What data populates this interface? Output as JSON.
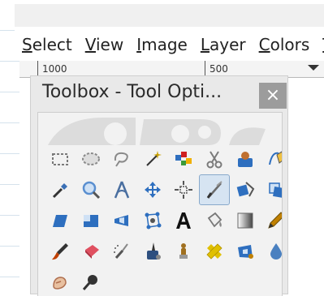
{
  "menubar": {
    "items": [
      {
        "label": "Select",
        "mnemonic": "S",
        "rest": "elect"
      },
      {
        "label": "View",
        "mnemonic": "V",
        "rest": "iew"
      },
      {
        "label": "Image",
        "mnemonic": "I",
        "rest": "mage"
      },
      {
        "label": "Layer",
        "mnemonic": "L",
        "rest": "ayer"
      },
      {
        "label": "Colors",
        "mnemonic": "C",
        "rest": "olors"
      },
      {
        "label": "To",
        "mnemonic": "T",
        "rest": "o"
      }
    ]
  },
  "ruler": {
    "labels": [
      "1000",
      "500"
    ]
  },
  "toolbox": {
    "title": "Toolbox - Tool Opti...",
    "close_glyph": "×"
  },
  "tools": [
    {
      "name": "rect-select-icon",
      "color": "#7a7a7a"
    },
    {
      "name": "ellipse-select-icon",
      "color": "#8a8a8a"
    },
    {
      "name": "free-select-icon",
      "color": "#8a8a8a"
    },
    {
      "name": "fuzzy-select-icon",
      "color": "#c8a000"
    },
    {
      "name": "select-by-color-icon",
      "color": "#d02020"
    },
    {
      "name": "scissors-select-icon",
      "color": "#7a7a7a"
    },
    {
      "name": "foreground-select-icon",
      "color": "#2e6fbf"
    },
    {
      "name": "paths-icon",
      "color": "#2e6fbf"
    },
    {
      "name": "color-picker-icon",
      "color": "#3a6fb5"
    },
    {
      "name": "zoom-icon",
      "color": "#5a8fd0"
    },
    {
      "name": "measure-icon",
      "color": "#4a6fa0"
    },
    {
      "name": "move-icon",
      "color": "#2e6fbf"
    },
    {
      "name": "alignment-icon",
      "color": "#555555"
    },
    {
      "name": "crop-icon",
      "color": "#6a6a6a",
      "active": true
    },
    {
      "name": "unified-transform-icon",
      "color": "#2e6fbf"
    },
    {
      "name": "rotate-icon",
      "color": "#2e6fbf"
    },
    {
      "name": "shear-icon",
      "color": "#2e6fbf"
    },
    {
      "name": "scale-icon",
      "color": "#2e6fbf"
    },
    {
      "name": "perspective-icon",
      "color": "#2e6fbf"
    },
    {
      "name": "cage-transform-icon",
      "color": "#2e6fbf"
    },
    {
      "name": "text-icon",
      "color": "#111111"
    },
    {
      "name": "bucket-fill-icon",
      "color": "#777777"
    },
    {
      "name": "blend-icon",
      "color": "#444444"
    },
    {
      "name": "pencil-icon",
      "color": "#c08000"
    },
    {
      "name": "paintbrush-icon",
      "color": "#c04000"
    },
    {
      "name": "eraser-icon",
      "color": "#e05060"
    },
    {
      "name": "airbrush-icon",
      "color": "#555555"
    },
    {
      "name": "ink-icon",
      "color": "#2e4f7f"
    },
    {
      "name": "clone-icon",
      "color": "#a07020"
    },
    {
      "name": "heal-icon",
      "color": "#e0c000"
    },
    {
      "name": "perspective-clone-icon",
      "color": "#2e6fbf"
    },
    {
      "name": "blur-sharpen-icon",
      "color": "#4a80c0"
    },
    {
      "name": "smudge-icon",
      "color": "#b07050"
    },
    {
      "name": "dodge-burn-icon",
      "color": "#333333"
    }
  ]
}
